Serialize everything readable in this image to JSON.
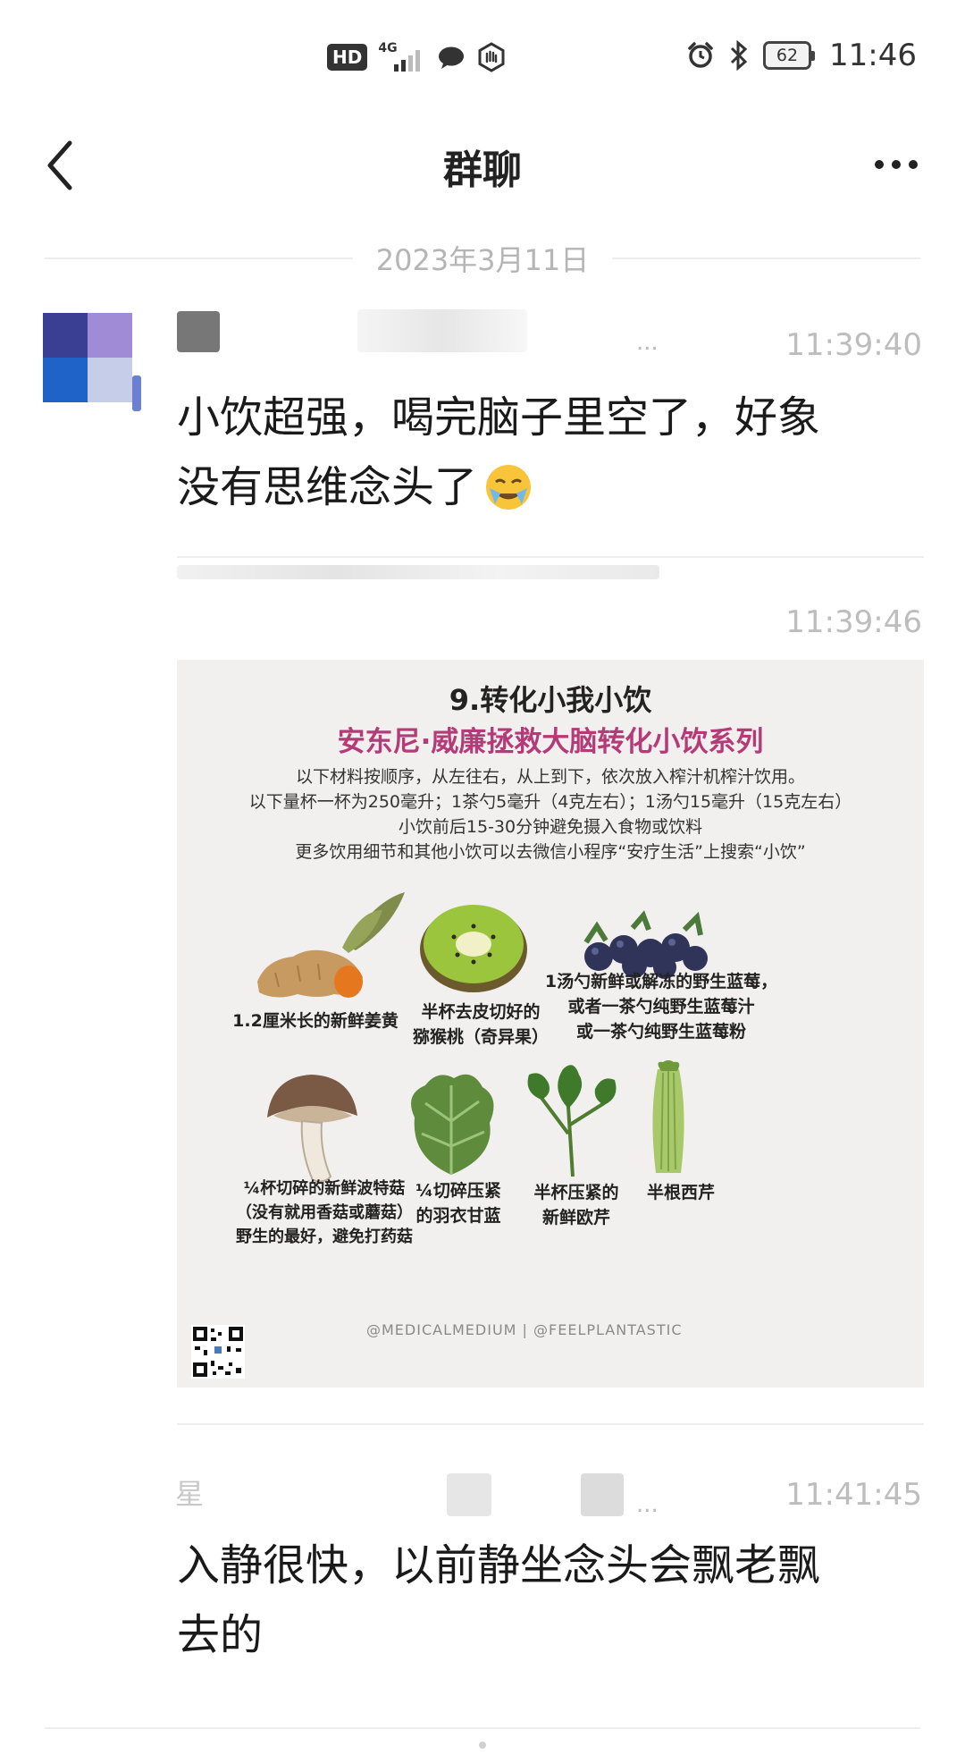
{
  "status_bar": {
    "hd_badge": "HD",
    "network": "4G",
    "battery_level": "62",
    "time": "11:46",
    "icons": [
      "hd-icon",
      "signal-icon",
      "chat-notification-icon",
      "app-notification-icon",
      "alarm-icon",
      "bluetooth-icon",
      "battery-icon"
    ]
  },
  "nav": {
    "title": "群聊",
    "back_icon": "chevron-left-icon",
    "more_icon": "more-dots-icon"
  },
  "date_divider": "2023年3月11日",
  "messages": [
    {
      "time": "11:39:40",
      "text_line1": "小饮超强，喝完脑子里空了，好象",
      "text_line2": "没有思维念头了",
      "emoji": "face-with-tears-emoji",
      "sender_tail": "..."
    },
    {
      "time": "11:39:46",
      "image": {
        "title": "9.转化小我小饮",
        "subtitle": "安东尼·威廉拯救大脑转化小饮系列",
        "lines": [
          "以下材料按顺序，从左往右，从上到下，依次放入榨汁机榨汁饮用。",
          "以下量杯一杯为250毫升；1茶勺5毫升（4克左右）；1汤勺15毫升（15克左右）",
          "小饮前后15-30分钟避免摄入食物或饮料",
          "更多饮用细节和其他小饮可以去微信小程序“安疗生活”上搜索“小饮”"
        ],
        "ingredients": [
          {
            "icon": "ginger-icon",
            "lines": [
              "1.2厘米长的新鲜姜黄"
            ]
          },
          {
            "icon": "kiwi-icon",
            "lines": [
              "半杯去皮切好的",
              "猕猴桃（奇异果）"
            ]
          },
          {
            "icon": "blueberry-icon",
            "lines": [
              "1汤勺新鲜或解冻的野生蓝莓，",
              "或者一茶勺纯野生蓝莓汁",
              "或一茶勺纯野生蓝莓粉"
            ]
          },
          {
            "icon": "mushroom-icon",
            "lines": [
              "¼杯切碎的新鲜波特菇",
              "（没有就用香菇或蘑菇）",
              "野生的最好，避免打药菇"
            ]
          },
          {
            "icon": "kale-icon",
            "lines": [
              "¼切碎压紧",
              "的羽衣甘蓝"
            ]
          },
          {
            "icon": "parsley-icon",
            "lines": [
              "半杯压紧的",
              "新鲜欧芹"
            ]
          },
          {
            "icon": "celery-icon",
            "lines": [
              "半根西芹"
            ]
          }
        ],
        "credit": "@MEDICALMEDIUM | @FEELPLANTASTIC",
        "qr_icon": "qr-code-icon"
      }
    },
    {
      "time": "11:41:45",
      "sender_first_char": "星",
      "sender_tail": "...",
      "text_line1": "入静很快，以前静坐念头会飘老飘",
      "text_line2": "去的"
    }
  ]
}
